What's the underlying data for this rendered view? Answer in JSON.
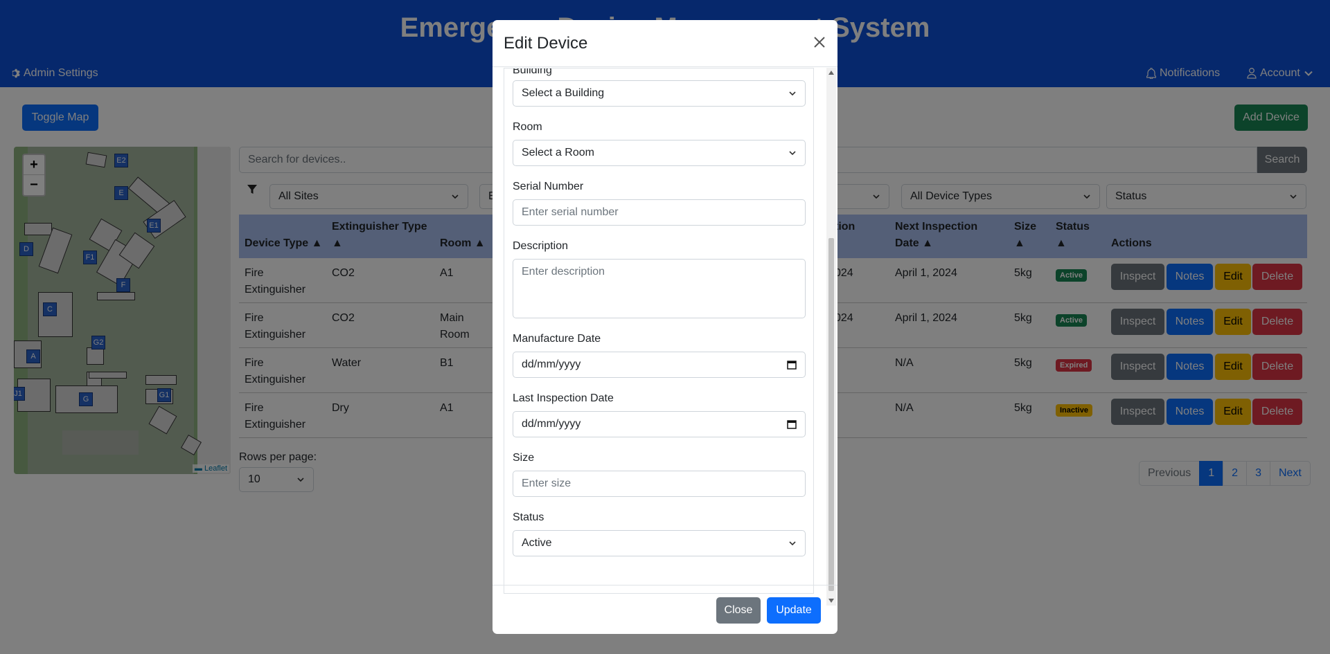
{
  "header": {
    "title": "Emergency Device Management System",
    "admin_settings": "Admin Settings",
    "notifications": "Notifications",
    "account": "Account"
  },
  "toolbar": {
    "toggle_map": "Toggle Map",
    "add_device": "Add Device"
  },
  "map": {
    "zoom_in": "+",
    "zoom_out": "−",
    "attribution": "Leaflet",
    "markers": [
      "E2",
      "E",
      "E1",
      "D",
      "F1",
      "F",
      "C",
      "G2",
      "A",
      "G1",
      "G",
      "J1"
    ]
  },
  "search": {
    "placeholder": "Search for devices..",
    "button": "Search"
  },
  "filters": {
    "sites": "All Sites",
    "buildings": "E",
    "device_types": "All Device Types",
    "status": "Status"
  },
  "table": {
    "headers": {
      "device_type": "Device Type ▲",
      "extinguisher_type": "Extinguisher Type",
      "extinguisher_arrow": "▲",
      "room": "Room ▲",
      "last_inspection": "tion",
      "next_inspection": "Next Inspection",
      "next_inspection_2": "Date ▲",
      "size": "Size",
      "size_arrow": "▲",
      "status": "Status",
      "status_arrow": "▲",
      "actions": "Actions"
    },
    "rows": [
      {
        "type_1": "Fire",
        "type_2": "Extinguisher",
        "ext": "CO2",
        "room_1": "A1",
        "room_2": "",
        "last": "024",
        "next": "April 1, 2024",
        "size": "5kg",
        "status": "Active"
      },
      {
        "type_1": "Fire",
        "type_2": "Extinguisher",
        "ext": "CO2",
        "room_1": "Main",
        "room_2": "Room",
        "last": "024",
        "next": "April 1, 2024",
        "size": "5kg",
        "status": "Active"
      },
      {
        "type_1": "Fire",
        "type_2": "Extinguisher",
        "ext": "Water",
        "room_1": "B1",
        "room_2": "",
        "last": "",
        "next": "N/A",
        "size": "5kg",
        "status": "Expired"
      },
      {
        "type_1": "Fire",
        "type_2": "Extinguisher",
        "ext": "Dry",
        "room_1": "A1",
        "room_2": "",
        "last": "",
        "next": "N/A",
        "size": "5kg",
        "status": "Inactive"
      }
    ],
    "actions": {
      "inspect": "Inspect",
      "notes": "Notes",
      "edit": "Edit",
      "delete": "Delete"
    },
    "status_colors": {
      "Active": "#198754",
      "Expired": "#dc3545",
      "Inactive": "#ffc107"
    }
  },
  "rows_per_page": {
    "label": "Rows per page:",
    "value": "10"
  },
  "pagination": {
    "previous": "Previous",
    "pages": [
      "1",
      "2",
      "3"
    ],
    "next": "Next",
    "current": "1"
  },
  "modal": {
    "title": "Edit Device",
    "building_label": "Building",
    "building_value": "Select a Building",
    "room_label": "Room",
    "room_value": "Select a Room",
    "serial_label": "Serial Number",
    "serial_placeholder": "Enter serial number",
    "description_label": "Description",
    "description_placeholder": "Enter description",
    "manufacture_label": "Manufacture Date",
    "manufacture_placeholder": "dd/mm/yyyy",
    "last_inspection_label": "Last Inspection Date",
    "last_inspection_placeholder": "dd/mm/yyyy",
    "size_label": "Size",
    "size_placeholder": "Enter size",
    "status_label": "Status",
    "status_value": "Active",
    "close_button": "Close",
    "update_button": "Update"
  }
}
